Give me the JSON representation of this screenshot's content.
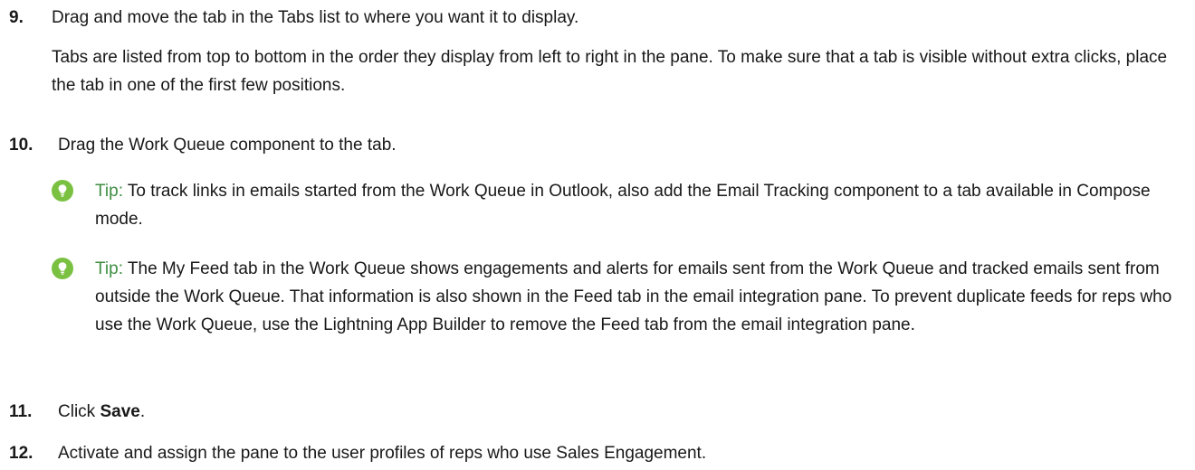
{
  "steps": [
    {
      "number": "9.",
      "text": "Drag and move the tab in the Tabs list to where you want it to display.",
      "paragraph": "Tabs are listed from top to bottom in the order they display from left to right in the pane. To make sure that a tab is visible without extra clicks, place the tab in one of the first few positions."
    },
    {
      "number": "10.",
      "text": "Drag the Work Queue component to the tab."
    },
    {
      "number": "11.",
      "text_before": "Click ",
      "text_bold": "Save",
      "text_after": "."
    },
    {
      "number": "12.",
      "text": "Activate and assign the pane to the user profiles of reps who use Sales Engagement."
    }
  ],
  "tips": [
    {
      "label": "Tip:",
      "text": "To track links in emails started from the Work Queue in Outlook, also add the Email Tracking component to a tab available in Compose mode."
    },
    {
      "label": "Tip:",
      "text": "The My Feed tab in the Work Queue shows engagements and alerts for emails sent from the Work Queue and tracked emails sent from outside the Work Queue. That information is also shown in the Feed tab in the email integration pane. To prevent duplicate feeds for reps who use the Work Queue, use the Lightning App Builder to remove the Feed tab from the email integration pane."
    }
  ],
  "colors": {
    "tip_accent": "#3e8e41",
    "tip_icon_fill": "#7ac142",
    "text": "#181818"
  },
  "icons": {
    "tip": "lightbulb-icon"
  }
}
